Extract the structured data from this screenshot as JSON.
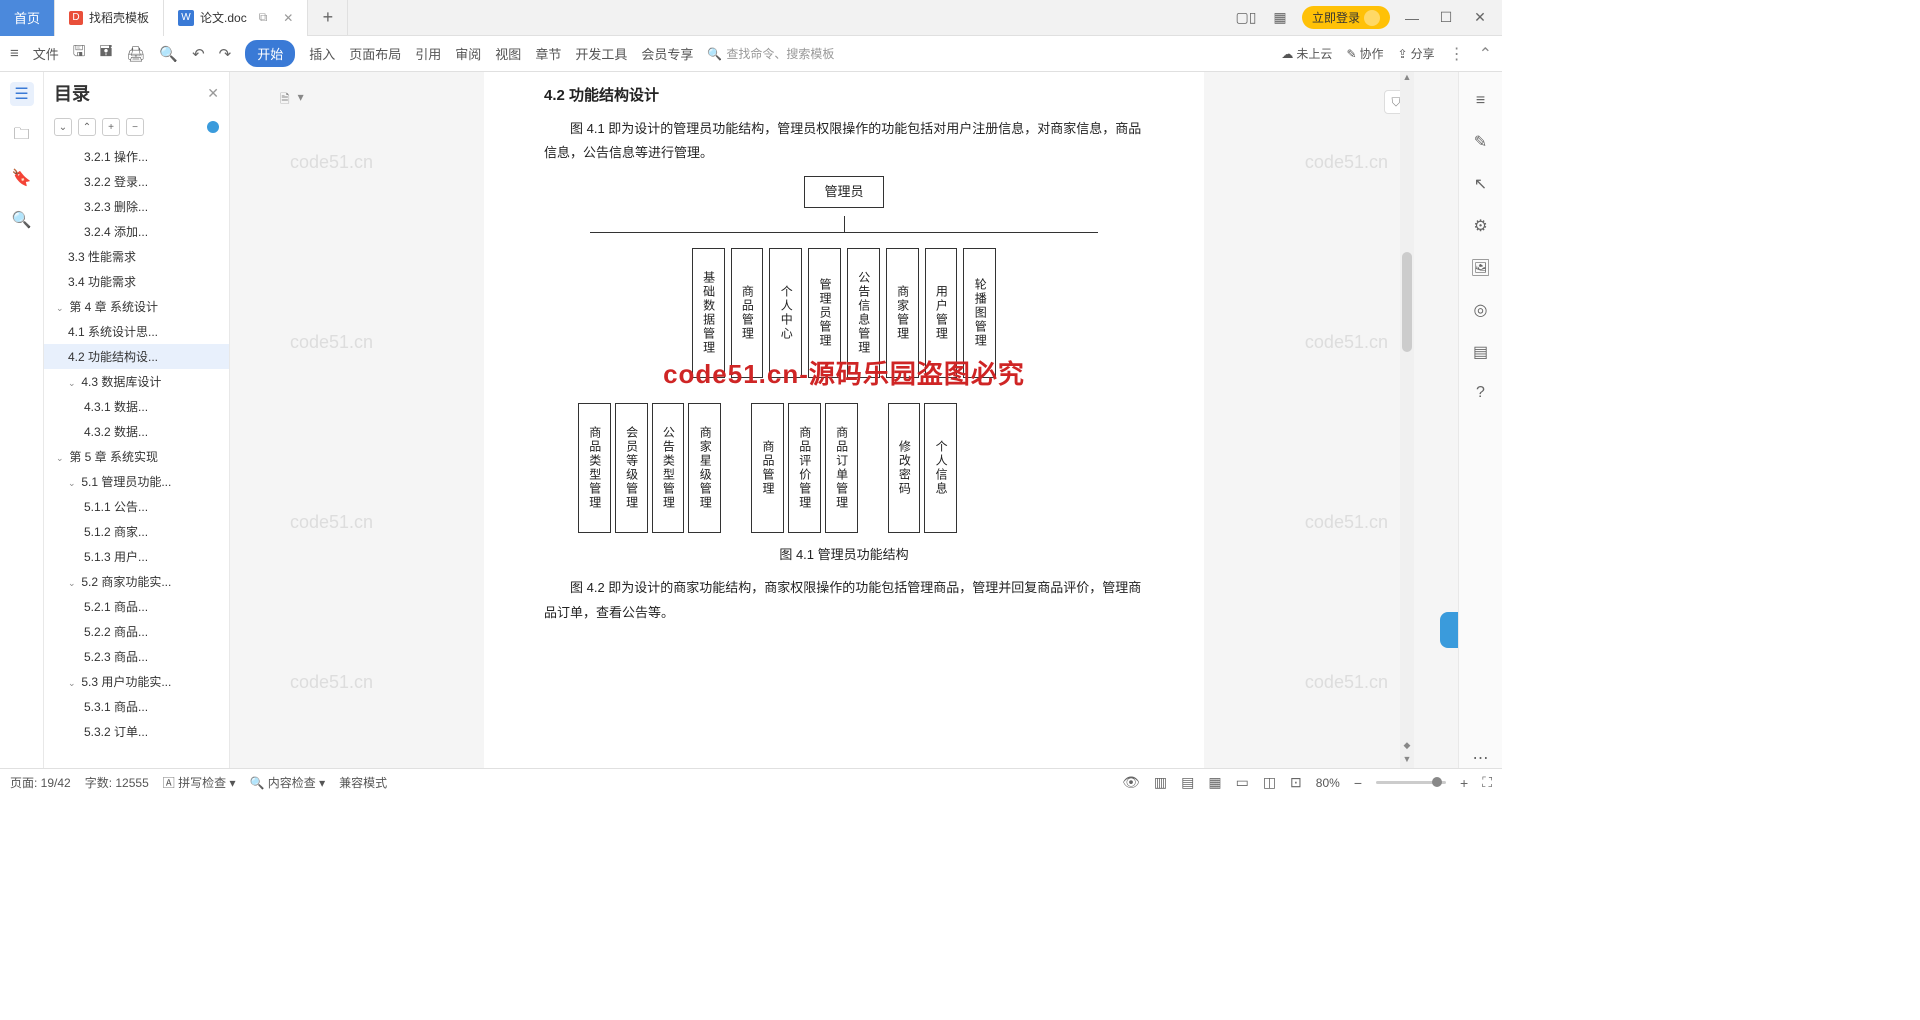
{
  "tabs": {
    "home": "首页",
    "tpl": "找稻壳模板",
    "doc": "论文.doc",
    "new": "+"
  },
  "login": "立即登录",
  "menu": {
    "file": "文件",
    "start": "开始",
    "insert": "插入",
    "layout": "页面布局",
    "ref": "引用",
    "review": "审阅",
    "view": "视图",
    "chapter": "章节",
    "dev": "开发工具",
    "vip": "会员专享",
    "search": "查找命令、搜索模板",
    "cloud": "未上云",
    "collab": "协作",
    "share": "分享"
  },
  "outline": {
    "title": "目录",
    "items": [
      {
        "l": 3,
        "t": "3.2.1 操作..."
      },
      {
        "l": 3,
        "t": "3.2.2 登录..."
      },
      {
        "l": 3,
        "t": "3.2.3 删除..."
      },
      {
        "l": 3,
        "t": "3.2.4 添加..."
      },
      {
        "l": 2,
        "t": "3.3 性能需求"
      },
      {
        "l": 2,
        "t": "3.4 功能需求"
      },
      {
        "l": 1,
        "t": "第 4 章 系统设计",
        "c": true
      },
      {
        "l": 2,
        "t": "4.1 系统设计思..."
      },
      {
        "l": 2,
        "t": "4.2 功能结构设...",
        "sel": true
      },
      {
        "l": 2,
        "t": "4.3 数据库设计",
        "c": true
      },
      {
        "l": 3,
        "t": "4.3.1 数据..."
      },
      {
        "l": 3,
        "t": "4.3.2 数据..."
      },
      {
        "l": 1,
        "t": "第 5 章 系统实现",
        "c": true
      },
      {
        "l": 2,
        "t": "5.1 管理员功能...",
        "c": true
      },
      {
        "l": 3,
        "t": "5.1.1 公告..."
      },
      {
        "l": 3,
        "t": "5.1.2 商家..."
      },
      {
        "l": 3,
        "t": "5.1.3 用户..."
      },
      {
        "l": 2,
        "t": "5.2 商家功能实...",
        "c": true
      },
      {
        "l": 3,
        "t": "5.2.1 商品..."
      },
      {
        "l": 3,
        "t": "5.2.2 商品..."
      },
      {
        "l": 3,
        "t": "5.2.3 商品..."
      },
      {
        "l": 2,
        "t": "5.3 用户功能实...",
        "c": true
      },
      {
        "l": 3,
        "t": "5.3.1 商品..."
      },
      {
        "l": 3,
        "t": "5.3.2 订单..."
      }
    ]
  },
  "doc": {
    "h": "4.2  功能结构设计",
    "p1": "图 4.1 即为设计的管理员功能结构，管理员权限操作的功能包括对用户注册信息，对商家信息，商品信息，公告信息等进行管理。",
    "root": "管理员",
    "l2": [
      "基础数据管理",
      "商品管理",
      "个人中心",
      "管理员管理",
      "公告信息管理",
      "商家管理",
      "用户管理",
      "轮播图管理"
    ],
    "l3a": [
      "商品类型管理",
      "会员等级管理",
      "公告类型管理",
      "商家星级管理"
    ],
    "l3b": [
      "商品管理",
      "商品评价管理",
      "商品订单管理"
    ],
    "l3c": [
      "修改密码",
      "个人信息"
    ],
    "cap": "图 4.1 管理员功能结构",
    "p2": "图 4.2 即为设计的商家功能结构，商家权限操作的功能包括管理商品，管理并回复商品评价，管理商品订单，查看公告等。",
    "wm": "code51.cn-源码乐园盗图必究"
  },
  "status": {
    "page": "页面: 19/42",
    "words": "字数: 12555",
    "spell": "拼写检查",
    "content": "内容检查",
    "compat": "兼容模式",
    "zoom": "80%"
  },
  "wm_faded": "code51.cn"
}
